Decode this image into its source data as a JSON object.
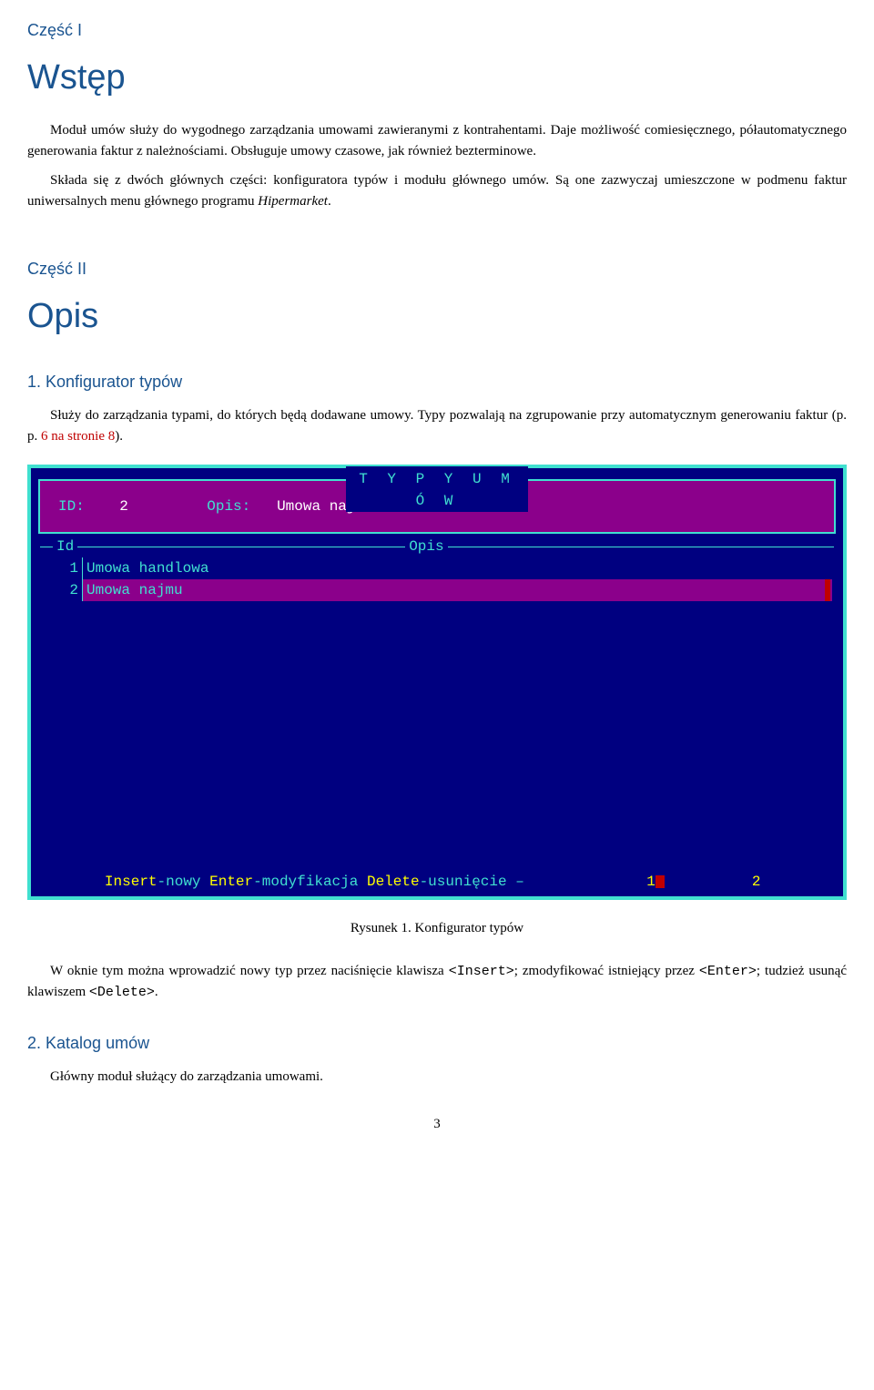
{
  "part1": {
    "label": "Część I",
    "title": "Wstęp",
    "paragraph": "Moduł umów służy do wygodnego zarządzania umowami zawieranymi z kontrahentami. Daje możliwość comiesięcznego, półautomatycznego generowania faktur z należnościami. Obsługuje umowy czasowe, jak również bezterminowe.",
    "paragraph2_a": "Składa się z dwóch głównych części: konfiguratora typów i modułu głównego umów. Są one zazwyczaj umieszczone w podmenu faktur uniwersalnych menu głównego programu ",
    "paragraph2_italic": "Hipermarket",
    "paragraph2_b": "."
  },
  "part2": {
    "label": "Część II",
    "title": "Opis"
  },
  "section1": {
    "heading": "1. Konfigurator typów",
    "para_a": "Służy do zarządzania typami, do których będą dodawane umowy. Typy pozwalają na zgrupowanie przy automatycznym generowaniu faktur (p. p. ",
    "para_link": "6 na stronie 8",
    "para_b": ")."
  },
  "terminal": {
    "title": "T Y P Y   U M Ó W",
    "header_id_label": "ID:",
    "header_id_value": "2",
    "header_opis_label": "Opis:",
    "header_opis_value": "Umowa najmu",
    "col_id": "Id",
    "col_opis": "Opis",
    "rows": [
      {
        "id": "1",
        "opis": "Umowa handlowa"
      },
      {
        "id": "2",
        "opis": "Umowa najmu"
      }
    ],
    "footer_insert_key": "Insert",
    "footer_insert_text": "-nowy ",
    "footer_enter_key": "Enter",
    "footer_enter_text": "-modyfikacja ",
    "footer_delete_key": "Delete",
    "footer_delete_text": "-usunięcie – ",
    "footer_page1": "1",
    "footer_page2": "2"
  },
  "figure": {
    "caption": "Rysunek 1. Konfigurator typów"
  },
  "para_after_a": "W oknie tym można wprowadzić nowy typ przez naciśnięcie klawisza ",
  "para_after_insert": "<Insert>",
  "para_after_b": "; zmodyfikować istniejący przez ",
  "para_after_enter": "<Enter>",
  "para_after_c": "; tudzież usunąć klawiszem ",
  "para_after_delete": "<Delete>",
  "para_after_d": ".",
  "section2": {
    "heading": "2. Katalog umów",
    "para": "Główny moduł służący do zarządzania umowami."
  },
  "page_number": "3"
}
